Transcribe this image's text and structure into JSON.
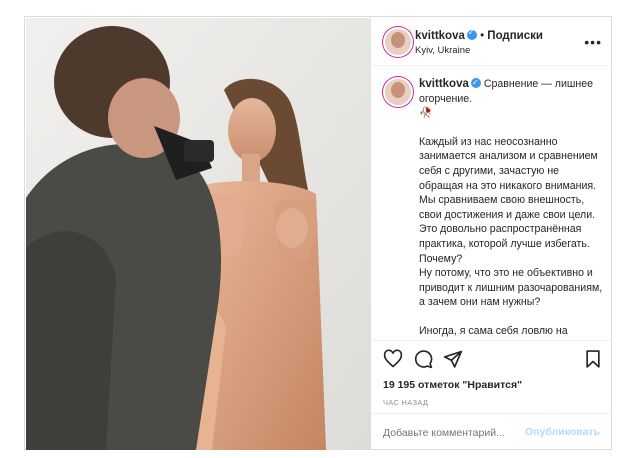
{
  "post": {
    "username": "kvittkova",
    "follow_label": "Подписки",
    "location": "Kyiv, Ukraine",
    "more_icon": "more-dots-icon",
    "caption_title": "Сравнение — лишнее огорчение.",
    "caption_emoji": "🥀",
    "caption_body_1": "Каждый из нас неосознанно занимается анализом и сравнением себя с другими, зачастую не обращая на это никакого внимания. Мы сравниваем свою внешность, свои достижения и даже свои цели. Это довольно распространённая практика, которой лучше избегать. Почему?",
    "caption_body_2": "Ну потому, что это не объективно и приводит к лишним разочарованиям, а зачем они нам нужны?",
    "caption_body_3": "Иногда, я сама себя ловлю на",
    "likes": "19 195 отметок \"Нравится\"",
    "time_ago": "ЧАС НАЗАД",
    "comment_placeholder": "Добавьте комментарий...",
    "post_button": "Опубликовать"
  },
  "colors": {
    "accent": "#3897f0",
    "post_disabled": "#b3dbff",
    "border": "#dbdbdb"
  }
}
